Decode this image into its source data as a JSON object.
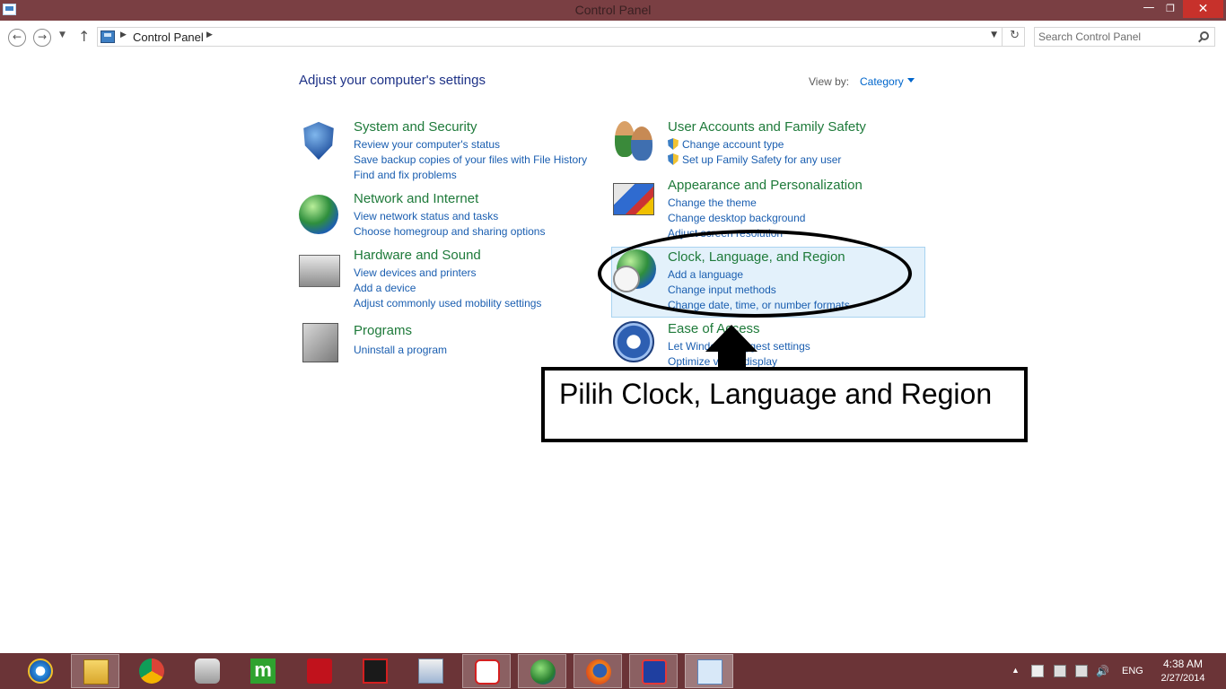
{
  "window": {
    "title": "Control Panel"
  },
  "address_bar": {
    "breadcrumb": "Control Panel",
    "search_placeholder": "Search Control Panel"
  },
  "main": {
    "heading": "Adjust your computer's settings",
    "view_by_label": "View by:",
    "view_by_value": "Category",
    "categories_left": [
      {
        "title": "System and Security",
        "icon": "security-shield-icon",
        "links": [
          "Review your computer's status",
          "Save backup copies of your files with File History",
          "Find and fix problems"
        ]
      },
      {
        "title": "Network and Internet",
        "icon": "network-globe-icon",
        "links": [
          "View network status and tasks",
          "Choose homegroup and sharing options"
        ]
      },
      {
        "title": "Hardware and Sound",
        "icon": "printer-icon",
        "links": [
          "View devices and printers",
          "Add a device",
          "Adjust commonly used mobility settings"
        ]
      },
      {
        "title": "Programs",
        "icon": "programs-icon",
        "links": [
          "Uninstall a program"
        ]
      }
    ],
    "categories_right": [
      {
        "title": "User Accounts and Family Safety",
        "icon": "users-icon",
        "links": [
          "Change account type",
          "Set up Family Safety for any user"
        ]
      },
      {
        "title": "Appearance and Personalization",
        "icon": "appearance-icon",
        "links": [
          "Change the theme",
          "Change desktop background",
          "Adjust screen resolution"
        ]
      },
      {
        "title": "Clock, Language, and Region",
        "icon": "clock-globe-icon",
        "links": [
          "Add a language",
          "Change input methods",
          "Change date, time, or number formats"
        ]
      },
      {
        "title": "Ease of Access",
        "icon": "ease-of-access-icon",
        "links": [
          "Let Windows suggest settings",
          "Optimize visual display"
        ]
      }
    ]
  },
  "annotation": {
    "text": "Pilih Clock, Language and Region"
  },
  "taskbar": {
    "apps": [
      "internet-explorer-icon",
      "file-explorer-icon",
      "chrome-icon",
      "camera-app-icon",
      "m-app-icon",
      "acrobat-icon",
      "red-app-icon",
      "monitor-app-icon",
      "s-app-icon",
      "download-manager-icon",
      "firefox-icon",
      "blue-app-icon",
      "control-panel-icon"
    ],
    "language": "ENG",
    "time": "4:38 AM",
    "date": "2/27/2014"
  }
}
